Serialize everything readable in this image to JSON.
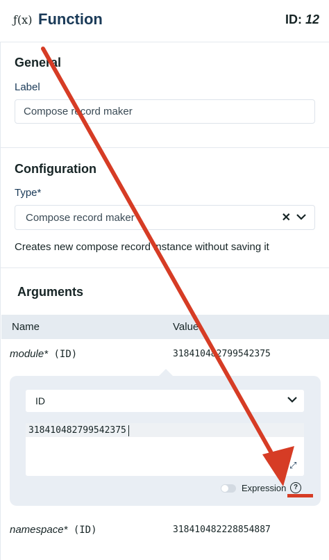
{
  "header": {
    "fx_icon": "ƒ(x)",
    "title": "Function",
    "id_label": "ID:",
    "id_value": "12"
  },
  "general": {
    "heading": "General",
    "label_label": "Label",
    "label_value": "Compose record maker"
  },
  "configuration": {
    "heading": "Configuration",
    "type_label": "Type*",
    "type_value": "Compose record maker",
    "clear_glyph": "✕",
    "chevron_glyph": "⌄",
    "description": "Creates new compose record instance without saving it"
  },
  "arguments": {
    "heading": "Arguments",
    "col_name": "Name",
    "col_value": "Value",
    "rows": [
      {
        "name": "module*",
        "type": "(ID)",
        "value": "318410482799542375"
      },
      {
        "name": "namespace*",
        "type": "(ID)",
        "value": "318410482228854887"
      }
    ],
    "editor": {
      "select_value": "ID",
      "input_value": "318410482799542375",
      "expression_label": "Expression",
      "help_glyph": "?",
      "expand_glyph": "⤢"
    }
  },
  "annotation_color": "#d63c25"
}
